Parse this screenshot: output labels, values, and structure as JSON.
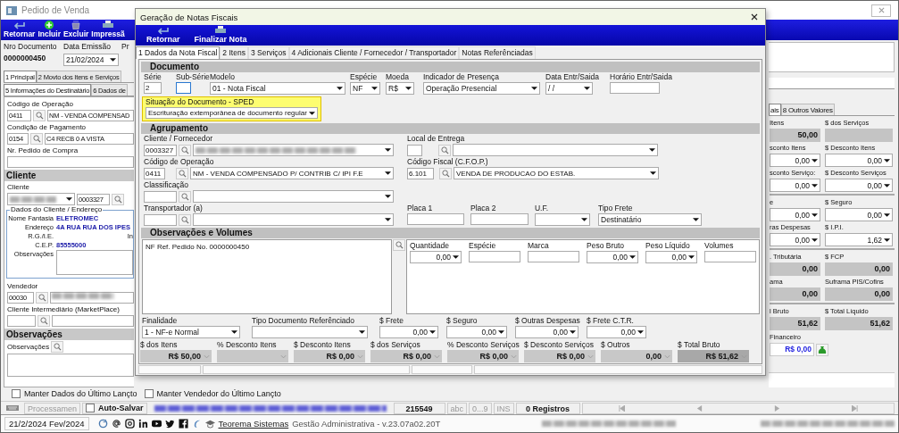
{
  "main_window": {
    "title": "Pedido de Venda",
    "toolbar": [
      "Retornar",
      "Incluir",
      "Excluir",
      "Impressã"
    ],
    "header": {
      "number_label": "Nro Documento",
      "number": "0000000450",
      "date_label": "Data Emissão",
      "date": "21/02/2024",
      "column_3_label": "Pr"
    },
    "tabs": [
      {
        "label": "1 Principal",
        "selected": true
      },
      {
        "label": "2 Movto dos Itens e Serviços",
        "selected": false
      }
    ],
    "subtabs": [
      {
        "label": "5 Informações do Destinatário",
        "selected": true
      },
      {
        "label": "6 Dados de",
        "selected": false
      }
    ],
    "operacao": {
      "label": "Código de Operação",
      "code": "0411",
      "value": "NM - VENDA COMPENSAD"
    },
    "pagamento": {
      "label": "Condição de Pagamento",
      "code": "0154",
      "value": "C4 RECB 0 A VISTA"
    },
    "pedido_compra": {
      "label": "Nr. Pedido de Compra"
    },
    "cliente_section": "Cliente",
    "cliente": {
      "label": "Cliente",
      "code": "0003327"
    },
    "dados_cliente": {
      "legend": "Dados do Cliente / Endereço",
      "column_2_label": "In",
      "rows": [
        {
          "label": "Nome Fantasia",
          "value": "ELETROMEC"
        },
        {
          "label": "Endereço",
          "value": "4A RUA RUA DOS IPES"
        },
        {
          "label": "R.G./I.E."
        },
        {
          "label": "C.E.P.",
          "value": "85555000"
        }
      ],
      "observacoes_label": "Observações"
    },
    "vendedor": {
      "label": "Vendedor",
      "code": "00030"
    },
    "intermediario": {
      "label": "Cliente Intermediário (MarketPlace)"
    },
    "observacoes_section": "Observações",
    "observacoes_label": "Observações",
    "right_panel": {
      "tabs": [
        {
          "label": "ais",
          "selected": true
        },
        {
          "label": "8 Outros Valores",
          "selected": false
        }
      ],
      "groups": [
        [
          [
            {
              "label": "Itens",
              "value": "50,00",
              "kind": "readonly"
            },
            {
              "label": "$ dos Serviços",
              "kind": "readonly"
            }
          ],
          [
            {
              "label": "sconto Itens",
              "value": "0,00",
              "kind": "dropdown"
            },
            {
              "label": "$ Desconto Itens",
              "value": "0,00",
              "kind": "dropdown"
            }
          ],
          [
            {
              "label": "sconto Serviço:",
              "value": "0,00",
              "kind": "dropdown"
            },
            {
              "label": "$ Desconto Serviços",
              "value": "0,00",
              "kind": "dropdown"
            }
          ]
        ],
        [
          [
            {
              "label": "e",
              "value": "0,00",
              "kind": "dropdown"
            },
            {
              "label": "$ Seguro",
              "value": "0,00",
              "kind": "dropdown"
            }
          ],
          [
            {
              "label": "ras Despesas",
              "value": "0,00",
              "kind": "dropdown"
            },
            {
              "label": "$ I.P.I.",
              "value": "1,62",
              "kind": "dropdown"
            }
          ]
        ],
        [
          [
            {
              "label": ". Tributária",
              "value": "0,00",
              "kind": "readonly"
            },
            {
              "label": "$ FCP",
              "value": "0,00",
              "kind": "readonly"
            }
          ],
          [
            {
              "label": "ama",
              "value": "0,00",
              "kind": "readonly"
            },
            {
              "label": "Suframa PIS/Cofins",
              "value": "0,00",
              "kind": "readonly"
            }
          ]
        ],
        [
          [
            {
              "label": "l Bruto",
              "value": "51,62",
              "kind": "readonly"
            },
            {
              "label": "$ Total Líquido",
              "value": "51,62",
              "kind": "readonly"
            }
          ]
        ]
      ],
      "financeiro": {
        "label": "Financeiro",
        "value": "R$ 0,00"
      }
    },
    "options": [
      {
        "label": "Manter Dados do Último Lançto",
        "checked": false
      },
      {
        "label": "Manter Vendedor do Último Lançto",
        "checked": false
      }
    ],
    "status_bar": {
      "processing": "Processamen",
      "autosave": {
        "label": "Auto-Salvar",
        "checked": false
      },
      "code": "215549",
      "indicators": [
        "abc",
        "0...9",
        "INS"
      ],
      "records": "0 Registros"
    }
  },
  "taskbar": {
    "date": "21/2/2024 Fev/2024",
    "link": "Teorema Sistemas",
    "version": "Gestão Administrativa - v.23.07a02.20T"
  },
  "dialog": {
    "title": "Geração de Notas Fiscais",
    "toolbar": [
      "Retornar",
      "Finalizar Nota"
    ],
    "tabs": [
      {
        "label": "1 Dados da Nota Fiscal",
        "selected": true
      },
      {
        "label": "2 Itens",
        "selected": false
      },
      {
        "label": "3 Serviços",
        "selected": false
      },
      {
        "label": "4 Adicionais Cliente / Fornecedor / Transportador",
        "selected": false
      },
      {
        "label": "Notas Referênciadas",
        "selected": false
      }
    ],
    "documento": {
      "title": "Documento",
      "fields": [
        {
          "label": "Série",
          "value": "2",
          "kind": "text",
          "focused": false
        },
        {
          "label": "Sub-Série",
          "kind": "text",
          "focused": true
        },
        {
          "label": "Modelo",
          "value": "01 - Nota Fiscal",
          "kind": "select",
          "focused": false
        },
        {
          "label": "Espécie",
          "value": "NF",
          "kind": "select",
          "focused": false
        },
        {
          "label": "Moeda",
          "value": "R$",
          "kind": "select",
          "focused": false
        },
        {
          "label": "Indicador de Presença",
          "value": "Operação Presencial",
          "kind": "select",
          "focused": false
        },
        {
          "label": "Data Entr/Saida",
          "value": " / /",
          "kind": "select",
          "focused": false
        },
        {
          "label": "Horário Entr/Saida",
          "kind": "text",
          "focused": false
        }
      ]
    },
    "situacao": {
      "label": "Situação do Documento - SPED",
      "value": "Escrituração extemporânea de documento regular",
      "highlighted": true
    },
    "agrupamento": {
      "title": "Agrupamento",
      "cliente": {
        "label": "Cliente / Fornecedor",
        "code": "0003327"
      },
      "local_entrega": {
        "label": "Local de Entrega"
      },
      "operacao": {
        "label": "Código de Operação",
        "code": "0411",
        "value": "NM - VENDA COMPENSADO P/ CONTRIB C/ IPI F.E"
      },
      "cfop": {
        "label": "Código Fiscal (C.F.O.P.)",
        "code": "6.101",
        "value": "VENDA DE PRODUCAO DO ESTAB."
      },
      "classificacao": {
        "label": "Classificação"
      },
      "transportador": {
        "label": "Transportador (a)"
      },
      "transport_fields": [
        {
          "label": "Placa 1",
          "kind": "text"
        },
        {
          "label": "Placa 2",
          "kind": "text"
        },
        {
          "label": "U.F.",
          "kind": "select"
        },
        {
          "label": "Tipo Frete",
          "value": "Destinatário",
          "kind": "select"
        }
      ]
    },
    "observacoes": {
      "title": "Observações e Volumes",
      "text": "NF Ref. Pedido No. 0000000450",
      "volumes": [
        {
          "label": "Quantidade",
          "value": "0,00",
          "kind": "number"
        },
        {
          "label": "Espécie",
          "kind": "text"
        },
        {
          "label": "Marca",
          "kind": "text"
        },
        {
          "label": "Peso Bruto",
          "value": "0,00",
          "kind": "number"
        },
        {
          "label": "Peso Líquido",
          "value": "0,00",
          "kind": "number"
        },
        {
          "label": "Volumes",
          "kind": "text"
        }
      ]
    },
    "finalidade": [
      {
        "label": "Finalidade",
        "value": "1 - NF-e Normal",
        "kind": "select"
      },
      {
        "label": "Tipo Documento Referênciado",
        "kind": "select"
      },
      {
        "label": "$ Frete",
        "value": "0,00",
        "kind": "number"
      },
      {
        "label": "$ Seguro",
        "value": "0,00",
        "kind": "number"
      },
      {
        "label": "$ Outras Despesas",
        "value": "0,00",
        "kind": "number"
      },
      {
        "label": "$ Frete C.T.R.",
        "value": "0,00",
        "kind": "number"
      }
    ],
    "totals": [
      {
        "label": "$ dos Itens",
        "value": "R$ 50,00",
        "highlighted": false
      },
      {
        "label": "% Desconto Itens",
        "highlighted": false
      },
      {
        "label": "$ Desconto Itens",
        "value": "R$ 0,00",
        "highlighted": false
      },
      {
        "label": "$ dos Serviços",
        "value": "R$ 0,00",
        "highlighted": false
      },
      {
        "label": "% Desconto Serviços",
        "value": "R$ 0,00",
        "highlighted": false
      },
      {
        "label": "$ Desconto Serviços",
        "value": "R$ 0,00",
        "highlighted": false
      },
      {
        "label": "$ Outros",
        "value": "0,00",
        "highlighted": false
      },
      {
        "label": "$ Total Bruto",
        "value": "R$ 51,62",
        "highlighted": true
      }
    ]
  }
}
